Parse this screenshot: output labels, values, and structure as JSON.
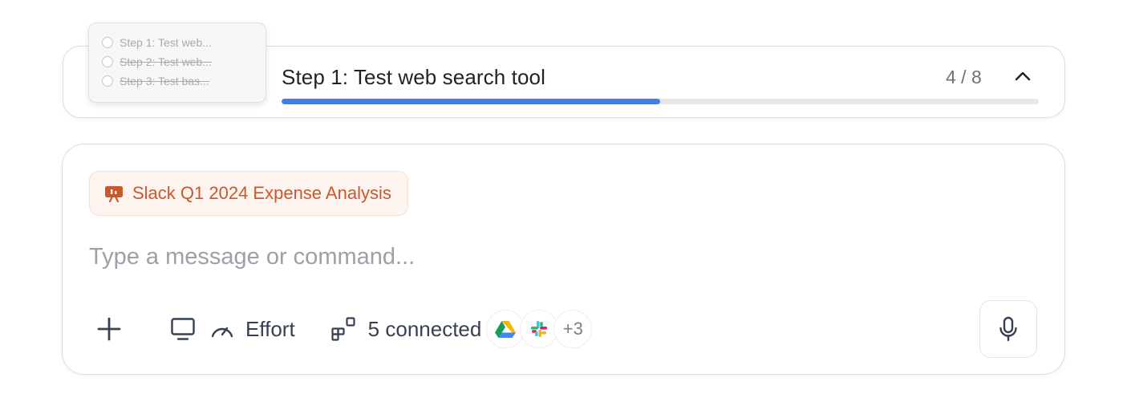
{
  "progress": {
    "current_step_title": "Step 1: Test web search tool",
    "counter": "4 / 8",
    "fraction_complete": 0.5,
    "accent": "#3b7ff0",
    "steps": [
      {
        "label": "Step 1: Test web...",
        "done": false
      },
      {
        "label": "Step 2: Test web...",
        "done": true
      },
      {
        "label": "Step 3: Test bas...",
        "done": true
      }
    ]
  },
  "composer": {
    "attachment": {
      "label": "Slack Q1 2024 Expense Analysis",
      "icon": "presentation-icon",
      "color": "#c8592c"
    },
    "input": {
      "placeholder": "Type a message or command...",
      "value": ""
    },
    "toolbar": {
      "add_icon": "plus-icon",
      "screen_icon": "monitor-icon",
      "effort_label": "Effort",
      "effort_icon": "gauge-icon",
      "connectors_label": "5 connected",
      "connectors_icon": "apps-icon",
      "apps": [
        "google-drive-icon",
        "slack-icon"
      ],
      "more_apps": "+3"
    },
    "mic_icon": "microphone-icon"
  }
}
